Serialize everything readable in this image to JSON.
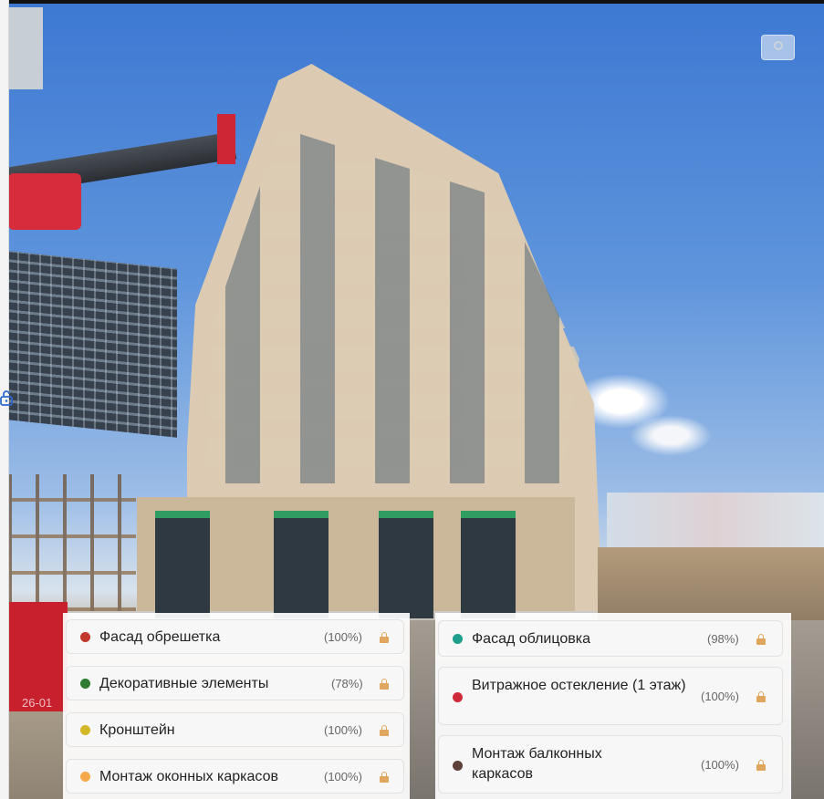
{
  "photo": {
    "description_icons": [
      "lock-icon",
      "eye-icon"
    ]
  },
  "legend": {
    "left_column": [
      {
        "label": "Фасад обрешетка",
        "percent": "(100%)",
        "color": "#c0392b"
      },
      {
        "label": "Декоративные элементы",
        "percent": "(78%)",
        "color": "#2e7d32"
      },
      {
        "label": "Кронштейн",
        "percent": "(100%)",
        "color": "#d4b726"
      },
      {
        "label": "Монтаж оконных каркасов",
        "percent": "(100%)",
        "color": "#f5a94a"
      }
    ],
    "right_column": [
      {
        "label": "Фасад облицовка",
        "percent": "(98%)",
        "color": "#1e9e8c"
      },
      {
        "label": "Витражное остекление (1 этаж)",
        "percent": "(100%)",
        "color": "#d02a3a"
      },
      {
        "label": "Монтаж балконных каркасов",
        "percent": "(100%)",
        "color": "#5d4037"
      }
    ]
  },
  "overlay": {
    "date_partial": "26-01"
  }
}
